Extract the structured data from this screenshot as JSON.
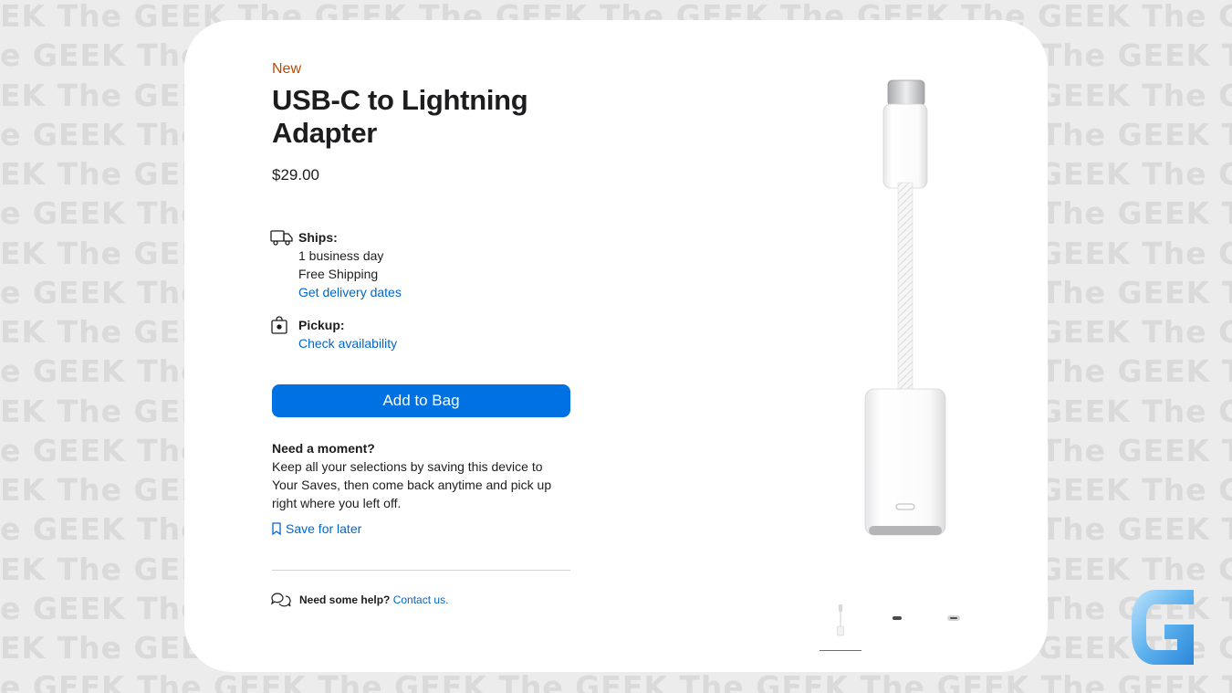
{
  "watermark": {
    "text_a": "EK The GEEK The GEEK The GEEK The GEEK The GEEK The GEEK The GEEK The GEEK The GE",
    "text_b": "e GEEK The GEEK The GEEK The GEEK The GEEK The GEEK The GEEK The GEEK The GEEK The"
  },
  "product": {
    "badge": "New",
    "title": "USB-C to Lightning Adapter",
    "price": "$29.00"
  },
  "ships": {
    "label": "Ships:",
    "time": "1 business day",
    "shipping": "Free Shipping",
    "link": "Get delivery dates"
  },
  "pickup": {
    "label": "Pickup:",
    "link": "Check availability"
  },
  "cta": {
    "add_to_bag": "Add to Bag"
  },
  "moment": {
    "heading": "Need a moment?",
    "body": "Keep all your selections by saving this device to Your Saves, then come back anytime and pick up right where you left off.",
    "save_link": "Save for later"
  },
  "help": {
    "question": "Need some help?",
    "link": "Contact us."
  },
  "gallery": {
    "selected_index": 0,
    "count": 3
  },
  "colors": {
    "accent": "#0071e3",
    "link": "#0066cc",
    "badge": "#bf4800"
  }
}
